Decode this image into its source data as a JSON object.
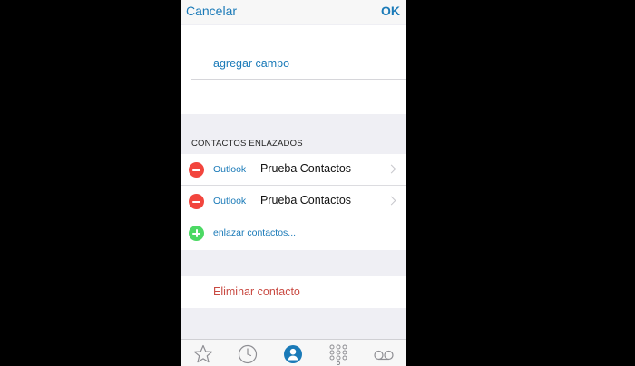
{
  "navbar": {
    "cancel_label": "Cancelar",
    "ok_label": "OK"
  },
  "fields": {
    "add_field_label": "agregar campo"
  },
  "linked_contacts": {
    "header": "CONTACTOS ENLAZADOS",
    "items": [
      {
        "source": "Outlook",
        "name": "Prueba Contactos"
      },
      {
        "source": "Outlook",
        "name": "Prueba Contactos"
      }
    ],
    "link_label": "enlazar contactos..."
  },
  "actions": {
    "delete_label": "Eliminar contacto"
  },
  "tabbar": {
    "tabs": [
      "star-icon",
      "clock-icon",
      "contacts-icon",
      "keypad-icon",
      "voicemail-icon"
    ],
    "active_tab": "contacts-icon"
  },
  "colors": {
    "accent": "#1a7ab8",
    "destructive": "#c94a42",
    "remove": "#f2453d",
    "add": "#4cd964",
    "background": "#efeff4"
  }
}
